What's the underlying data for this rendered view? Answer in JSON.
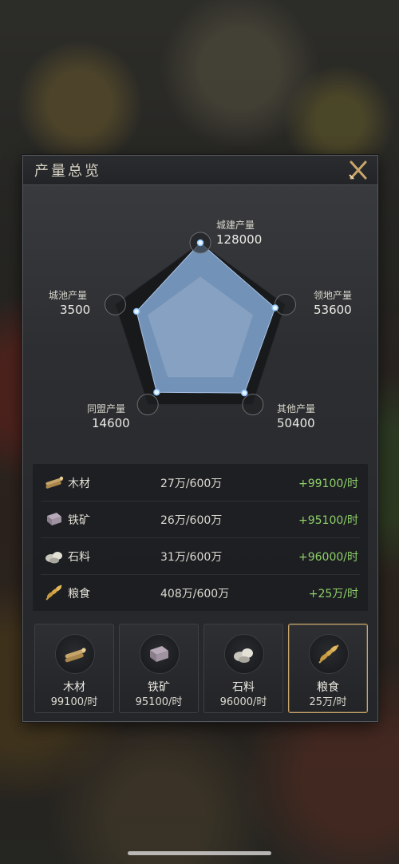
{
  "title": "产量总览",
  "radar": {
    "vertices": [
      {
        "label": "城建产量",
        "value": "128000",
        "ratio": 1.0
      },
      {
        "label": "领地产量",
        "value": "53600",
        "ratio": 0.88
      },
      {
        "label": "其他产量",
        "value": "50400",
        "ratio": 0.84
      },
      {
        "label": "同盟产量",
        "value": "14600",
        "ratio": 0.83
      },
      {
        "label": "城池产量",
        "value": "3500",
        "ratio": 0.75
      }
    ],
    "fill_color": "#7c9cc4",
    "frame_color": "#18191b"
  },
  "resources": [
    {
      "name": "木材",
      "amount": "27万/600万",
      "rate": "+99100/时",
      "icon": "wood-icon"
    },
    {
      "name": "铁矿",
      "amount": "26万/600万",
      "rate": "+95100/时",
      "icon": "iron-ore-icon"
    },
    {
      "name": "石料",
      "amount": "31万/600万",
      "rate": "+96000/时",
      "icon": "stone-icon"
    },
    {
      "name": "粮食",
      "amount": "408万/600万",
      "rate": "+25万/时",
      "icon": "grain-icon"
    }
  ],
  "cards": [
    {
      "name": "木材",
      "rate": "99100/时",
      "icon": "wood-icon",
      "selected": false
    },
    {
      "name": "铁矿",
      "rate": "95100/时",
      "icon": "iron-ore-icon",
      "selected": false
    },
    {
      "name": "石料",
      "rate": "96000/时",
      "icon": "stone-icon",
      "selected": false
    },
    {
      "name": "粮食",
      "rate": "25万/时",
      "icon": "grain-icon",
      "selected": true
    }
  ],
  "colors": {
    "accent_gold": "#c9a56a",
    "rate_green": "#8fcf6a"
  }
}
